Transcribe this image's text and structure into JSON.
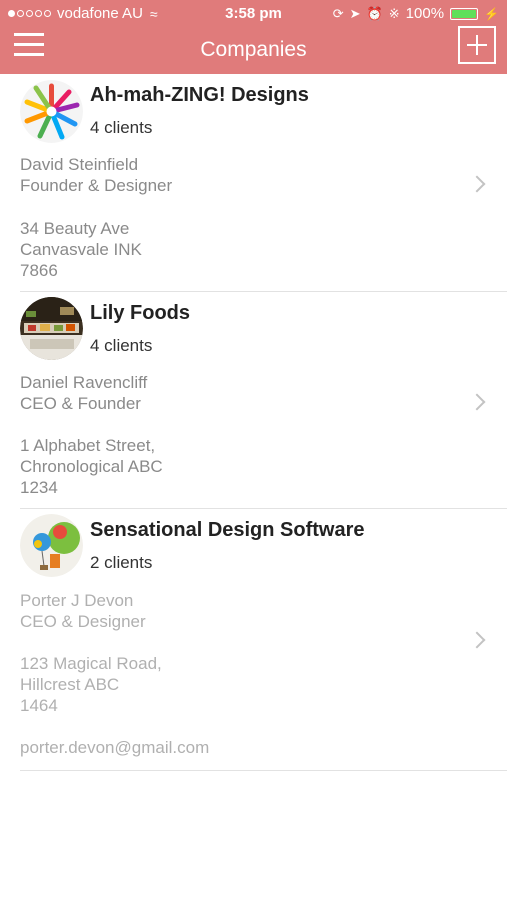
{
  "status_bar": {
    "carrier": "vodafone AU",
    "time": "3:58 pm",
    "battery": "100%"
  },
  "nav": {
    "title": "Companies",
    "menu_icon": "hamburger-menu-icon",
    "add_icon": "add-icon"
  },
  "companies": [
    {
      "name": "Ah-mah-ZING! Designs",
      "clients": "4 clients",
      "contact_name": "David Steinfield",
      "contact_role": "Founder & Designer",
      "address_line1": "34 Beauty Ave",
      "address_line2": "Canvasvale INK",
      "address_line3": "7866"
    },
    {
      "name": "Lily Foods",
      "clients": "4 clients",
      "contact_name": "Daniel Ravencliff",
      "contact_role": "CEO & Founder",
      "address_line1": "1 Alphabet Street,",
      "address_line2": "Chronological ABC",
      "address_line3": "1234"
    },
    {
      "name": "Sensational Design Software",
      "clients": "2 clients",
      "contact_name": "Porter J Devon",
      "contact_role": "CEO & Designer",
      "address_line1": "123 Magical Road,",
      "address_line2": "Hillcrest ABC",
      "address_line3": "1464",
      "email": "porter.devon@gmail.com"
    }
  ],
  "colors": {
    "header_bg": "#e07b7b",
    "battery_fill": "#5fe05a"
  }
}
